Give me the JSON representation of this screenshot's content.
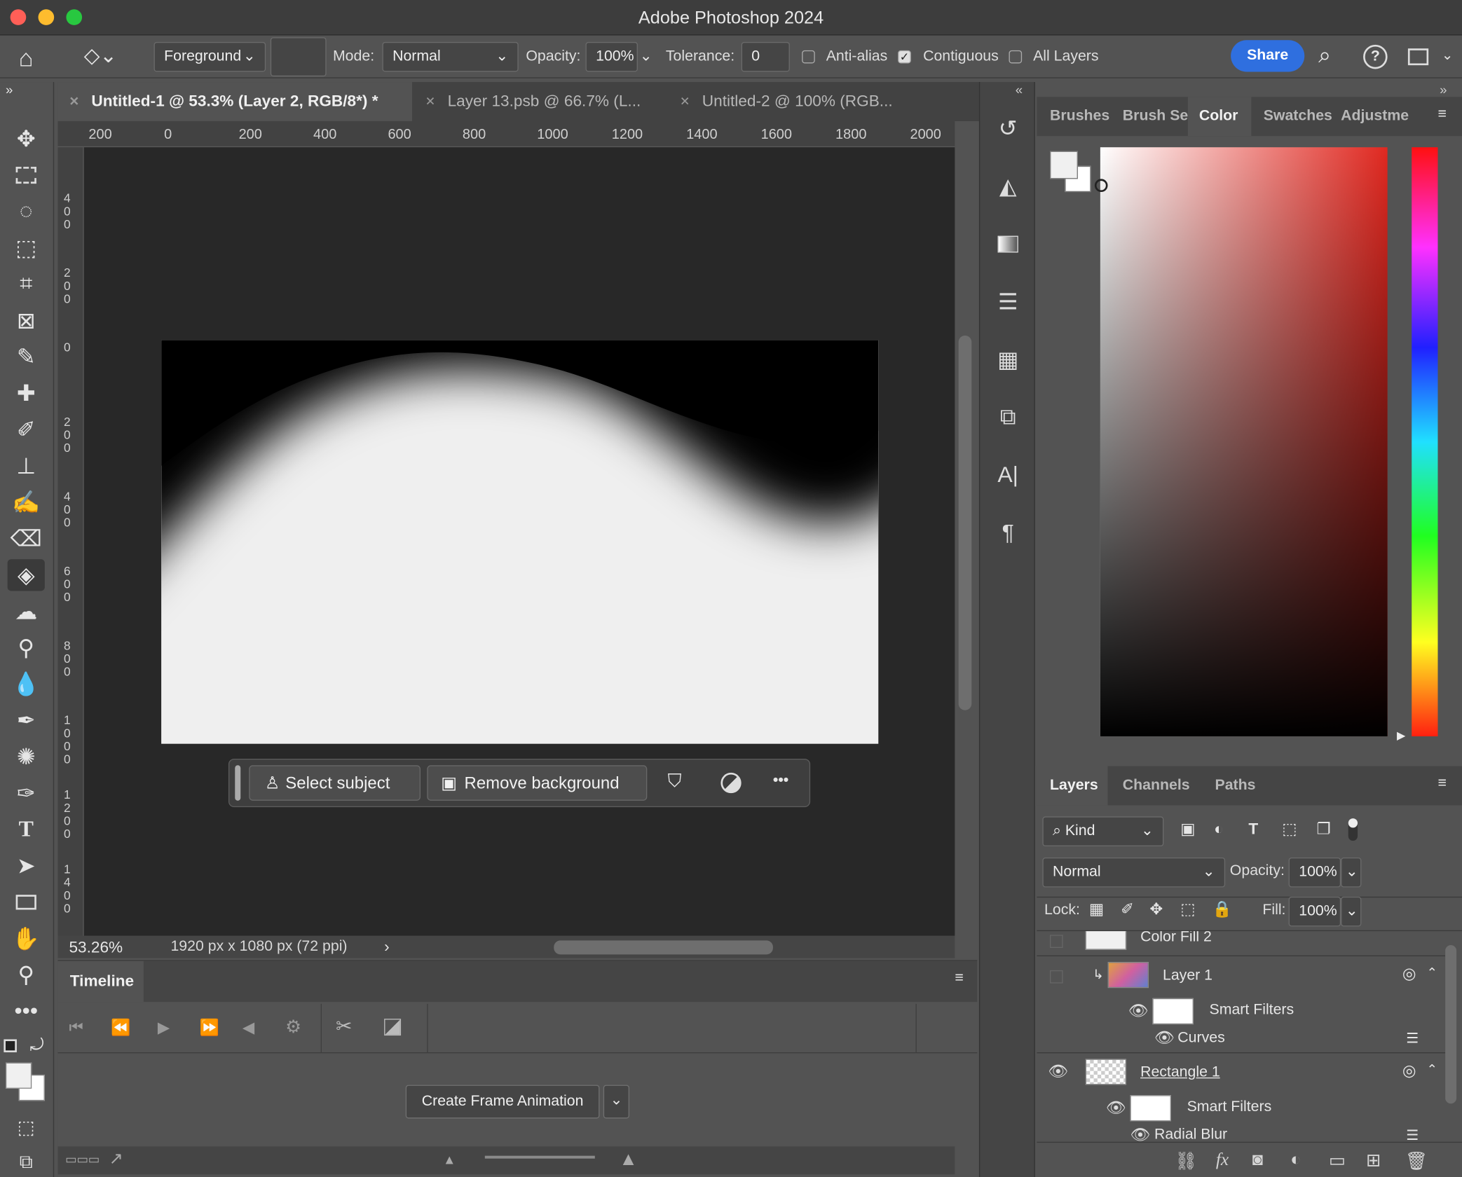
{
  "window": {
    "title": "Adobe Photoshop 2024"
  },
  "options": {
    "fill_source": "Foreground",
    "mode_label": "Mode:",
    "mode_value": "Normal",
    "opacity_label": "Opacity:",
    "opacity_value": "100%",
    "tolerance_label": "Tolerance:",
    "tolerance_value": "0",
    "antialias_label": "Anti-alias",
    "antialias_checked": false,
    "contiguous_label": "Contiguous",
    "contiguous_checked": true,
    "alllayers_label": "All Layers",
    "alllayers_checked": false,
    "share_label": "Share"
  },
  "doc_tabs": [
    {
      "label": "Untitled-1 @ 53.3% (Layer 2, RGB/8*) *",
      "active": true
    },
    {
      "label": "Layer 13.psb @ 66.7% (L...",
      "active": false
    },
    {
      "label": "Untitled-2 @ 100% (RGB...",
      "active": false
    }
  ],
  "ruler": {
    "horizontal": [
      "200",
      "0",
      "200",
      "400",
      "600",
      "800",
      "1000",
      "1200",
      "1400",
      "1600",
      "1800",
      "2000"
    ],
    "vertical": [
      "400",
      "200",
      "0",
      "200",
      "400",
      "600",
      "800",
      "1000",
      "1200",
      "1400"
    ]
  },
  "status": {
    "zoom": "53.26%",
    "doc_info": "1920 px x 1080 px (72 ppi)",
    "arrow": "›"
  },
  "context_bar": {
    "select_subject": "Select subject",
    "remove_background": "Remove background",
    "more": "•••"
  },
  "timeline": {
    "tab": "Timeline",
    "create_button": "Create Frame Animation"
  },
  "color_panel": {
    "tabs": [
      "Brushes",
      "Brush Set",
      "Color",
      "Swatches",
      "Adjustme"
    ],
    "active_tab": "Color",
    "foreground": "#f0f0f0",
    "background": "#ffffff"
  },
  "layers_panel": {
    "tabs": [
      "Layers",
      "Channels",
      "Paths"
    ],
    "filter_label": "Kind",
    "blend_mode": "Normal",
    "opacity_label": "Opacity:",
    "opacity_value": "100%",
    "lock_label": "Lock:",
    "fill_label": "Fill:",
    "fill_value": "100%",
    "rows": {
      "color_fill": "Color Fill 2",
      "layer1": "Layer 1",
      "smart_filters_1": "Smart Filters",
      "curves": "Curves",
      "rectangle1": "Rectangle 1",
      "smart_filters_2": "Smart Filters",
      "radial_blur": "Radial Blur"
    }
  },
  "colors": {
    "accent": "#2f6fdf",
    "panel": "#535353",
    "canvas_bg": "#282828"
  }
}
